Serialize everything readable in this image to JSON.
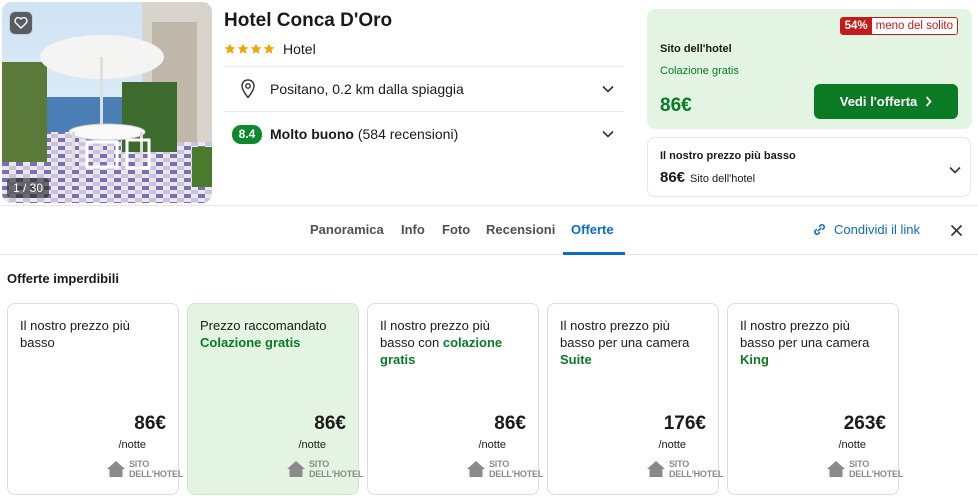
{
  "hotel": {
    "name": "Hotel Conca D'Oro",
    "stars": 4,
    "type": "Hotel",
    "photo_counter": "1 / 30",
    "location": "Positano, 0.2 km dalla spiaggia",
    "rating_score": "8.4",
    "rating_label": "Molto buono",
    "reviews": "(584 recensioni)"
  },
  "offer": {
    "discount_pct": "54%",
    "discount_text": "meno del solito",
    "site": "Sito dell'hotel",
    "perk": "Colazione gratis",
    "price": "86€",
    "button_label": "Vedi l'offerta"
  },
  "lowest": {
    "title": "Il nostro prezzo più basso",
    "price": "86€",
    "site": "Sito dell'hotel"
  },
  "tabs": [
    {
      "label": "Panoramica"
    },
    {
      "label": "Info"
    },
    {
      "label": "Foto"
    },
    {
      "label": "Recensioni"
    },
    {
      "label": "Offerte",
      "active": true
    }
  ],
  "share_label": "Condividi il link",
  "deals_title": "Offerte imperdibili",
  "deals": [
    {
      "desc": "Il nostro prezzo più basso",
      "highlight": "",
      "price": "86€",
      "per": "/notte",
      "logo_line1": "SITO",
      "logo_line2": "DELL'HOTEL"
    },
    {
      "desc": "Prezzo raccomandato",
      "highlight": "Colazione gratis",
      "price": "86€",
      "per": "/notte",
      "logo_line1": "SITO",
      "logo_line2": "DELL'HOTEL"
    },
    {
      "desc": "Il nostro prezzo più basso con",
      "highlight": "colazione gratis",
      "price": "86€",
      "per": "/notte",
      "logo_line1": "SITO",
      "logo_line2": "DELL'HOTEL"
    },
    {
      "desc": "Il nostro prezzo più basso per una camera",
      "highlight": "Suite",
      "price": "176€",
      "per": "/notte",
      "logo_line1": "SITO",
      "logo_line2": "DELL'HOTEL"
    },
    {
      "desc": "Il nostro prezzo più basso per una camera",
      "highlight": "King",
      "price": "263€",
      "per": "/notte",
      "logo_line1": "SITO",
      "logo_line2": "DELL'HOTEL"
    }
  ],
  "colors": {
    "green": "#0a7a25",
    "blue": "#0a6cc4",
    "red": "#c41a1a",
    "star": "#f0a500"
  }
}
